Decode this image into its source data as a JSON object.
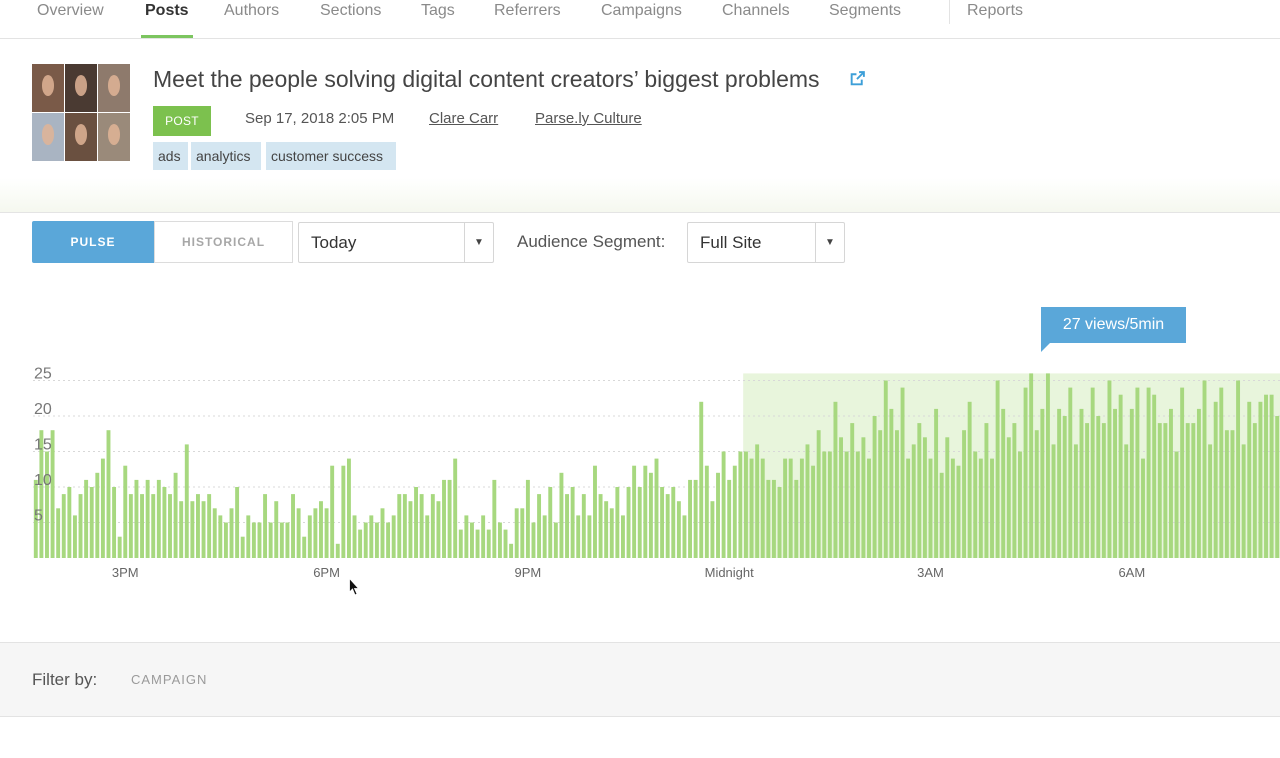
{
  "nav": {
    "items": [
      {
        "label": "Overview"
      },
      {
        "label": "Posts",
        "active": true
      },
      {
        "label": "Authors"
      },
      {
        "label": "Sections"
      },
      {
        "label": "Tags"
      },
      {
        "label": "Referrers"
      },
      {
        "label": "Campaigns"
      },
      {
        "label": "Channels"
      },
      {
        "label": "Segments"
      },
      {
        "label": "Reports"
      }
    ]
  },
  "post": {
    "title": "Meet the people solving digital content creators’ biggest problems",
    "badge": "POST",
    "date": "Sep 17, 2018 2:05 PM",
    "author": "Clare Carr",
    "section": "Parse.ly Culture",
    "tags": [
      "ads",
      "analytics",
      "customer success"
    ]
  },
  "controls": {
    "pulse_label": "PULSE",
    "historical_label": "HISTORICAL",
    "period_value": "Today",
    "audience_label": "Audience Segment:",
    "audience_value": "Full Site"
  },
  "tooltip": "27 views/5min",
  "filter": {
    "label": "Filter by:",
    "campaign": "CAMPAIGN"
  },
  "colors": {
    "accent_blue": "#5aa7d9",
    "bar_green": "#a7d87f",
    "highlight_green": "#e8f5dc",
    "badge_green": "#7cc14e",
    "nav_underline": "#7cc55f",
    "tag_bg": "#d4e6f1",
    "link_icon": "#3d9fd8"
  },
  "chart_data": {
    "type": "bar",
    "ylabels": [
      "25",
      "20",
      "15",
      "10",
      "5"
    ],
    "yticks": [
      25,
      20,
      15,
      10,
      5
    ],
    "ylim": [
      0,
      26
    ],
    "xticks": [
      {
        "label": "3PM",
        "index": 16
      },
      {
        "label": "6PM",
        "index": 52
      },
      {
        "label": "9PM",
        "index": 88
      },
      {
        "label": "Midnight",
        "index": 124
      },
      {
        "label": "3AM",
        "index": 160
      },
      {
        "label": "6AM",
        "index": 196
      }
    ],
    "highlight_from_index": 127,
    "grid": true,
    "values": [
      11,
      18,
      15,
      18,
      7,
      9,
      10,
      6,
      9,
      11,
      10,
      12,
      14,
      18,
      10,
      3,
      13,
      9,
      11,
      9,
      11,
      9,
      11,
      10,
      9,
      12,
      8,
      16,
      8,
      9,
      8,
      9,
      7,
      6,
      5,
      7,
      10,
      3,
      6,
      5,
      5,
      9,
      5,
      8,
      5,
      5,
      9,
      7,
      3,
      6,
      7,
      8,
      7,
      13,
      2,
      13,
      14,
      6,
      4,
      5,
      6,
      5,
      7,
      5,
      6,
      9,
      9,
      8,
      10,
      9,
      6,
      9,
      8,
      11,
      11,
      14,
      4,
      6,
      5,
      4,
      6,
      4,
      11,
      5,
      4,
      2,
      7,
      7,
      11,
      5,
      9,
      6,
      10,
      5,
      12,
      9,
      10,
      6,
      9,
      6,
      13,
      9,
      8,
      7,
      10,
      6,
      10,
      13,
      10,
      13,
      12,
      14,
      10,
      9,
      10,
      8,
      6,
      11,
      11,
      22,
      13,
      8,
      12,
      15,
      11,
      13,
      15,
      15,
      14,
      16,
      14,
      11,
      11,
      10,
      14,
      14,
      11,
      14,
      16,
      13,
      18,
      15,
      15,
      22,
      17,
      15,
      19,
      15,
      17,
      14,
      20,
      18,
      25,
      21,
      18,
      24,
      14,
      16,
      19,
      17,
      14,
      21,
      12,
      17,
      14,
      13,
      18,
      22,
      15,
      14,
      19,
      14,
      25,
      21,
      17,
      19,
      15,
      24,
      26,
      18,
      21,
      26,
      16,
      21,
      20,
      24,
      16,
      21,
      19,
      24,
      20,
      19,
      25,
      21,
      23,
      16,
      21,
      24,
      14,
      24,
      23,
      19,
      19,
      21,
      15,
      24,
      19,
      19,
      21,
      25,
      16,
      22,
      24,
      18,
      18,
      25,
      16,
      22,
      19,
      22,
      23,
      23,
      20
    ]
  }
}
